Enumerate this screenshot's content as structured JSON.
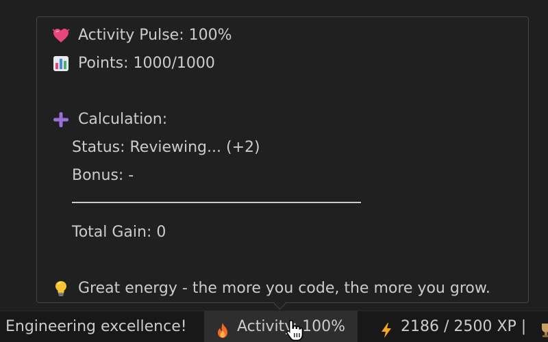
{
  "tooltip": {
    "pulse": "Activity Pulse: 100%",
    "points": "Points: 1000/1000",
    "calc_heading": "Calculation:",
    "status": "Status: Reviewing... (+2)",
    "bonus": "Bonus: -",
    "total": "Total Gain: 0",
    "tip": "Great energy - the more you code, the more you grow."
  },
  "icons": {
    "pulse": "heart-icon",
    "points": "chart-icon",
    "calc": "plus-icon",
    "tip": "lightbulb-icon",
    "activity": "flame-icon",
    "xp": "lightning-icon",
    "trophy": "trophy-icon"
  },
  "statusbar": {
    "message": "Engineering excellence!",
    "activity": "Activity: 100%",
    "xp": "2186 / 2500 XP |"
  },
  "colors": {
    "background": "#1f1f1f",
    "tooltip_border": "#454545",
    "text": "#cccccc",
    "heart": "#e8457a",
    "plus": "#9b6fd8",
    "flame": "#f36b2b",
    "lightning": "#f5a623"
  }
}
